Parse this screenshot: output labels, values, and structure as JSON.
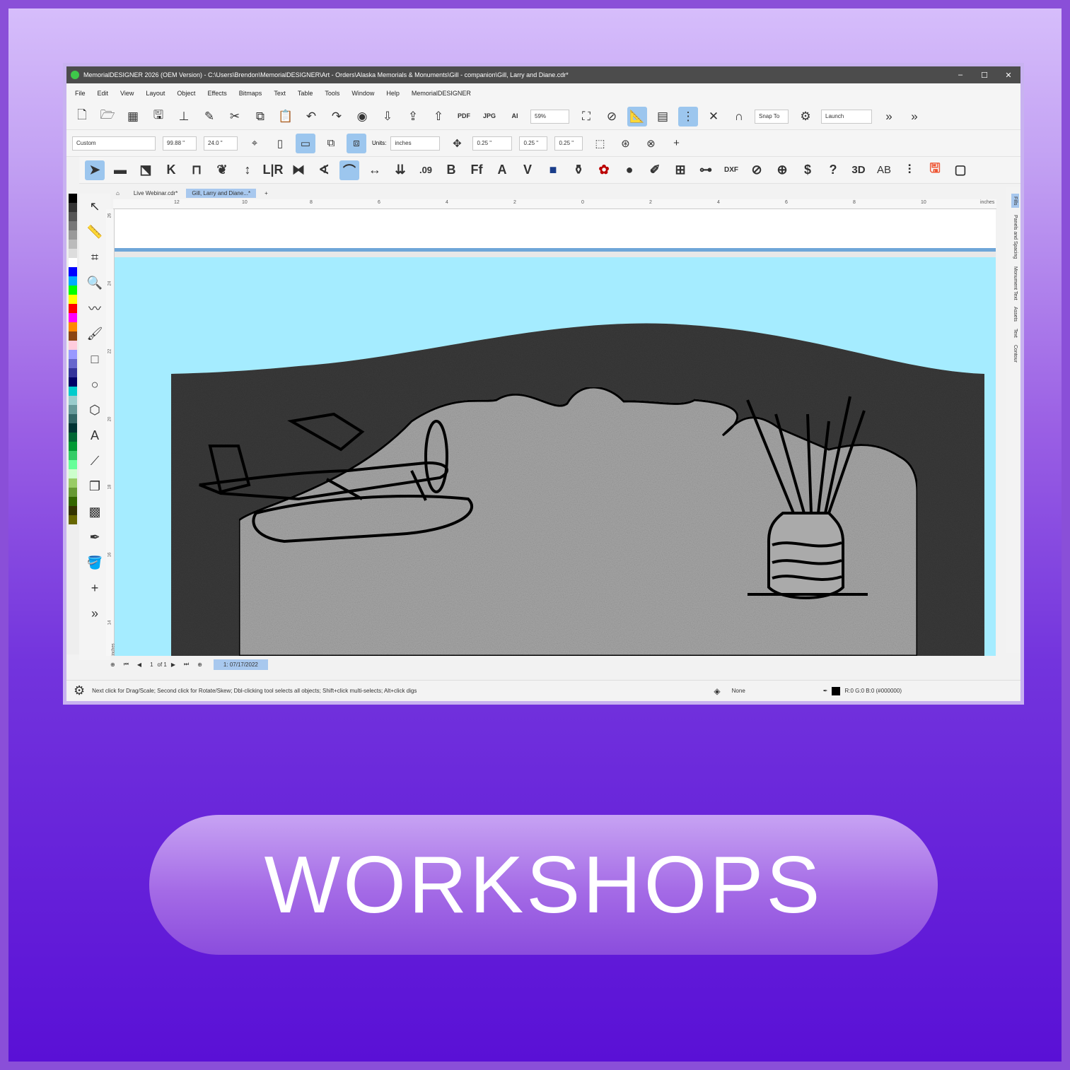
{
  "window": {
    "title": "MemorialDESIGNER 2026 (OEM Version) - C:\\Users\\Brendon\\MemorialDESIGNER\\Art - Orders\\Alaska Memorials & Monuments\\Gill - companion\\Gill, Larry and Diane.cdr*",
    "controls": [
      "–",
      "☐",
      "✕"
    ]
  },
  "menu": [
    "File",
    "Edit",
    "View",
    "Layout",
    "Object",
    "Effects",
    "Bitmaps",
    "Text",
    "Table",
    "Tools",
    "Window",
    "Help",
    "MemorialDESIGNER"
  ],
  "toolbar": {
    "pdf": "PDF",
    "jpg": "JPG",
    "ai": "AI",
    "zoom": "59%",
    "snap": "Snap To",
    "launch": "Launch"
  },
  "propbar": {
    "preset": "Custom",
    "width": "99.88 \"",
    "height": "24.0 \"",
    "units_label": "Units:",
    "units": "inches",
    "nudge": "0.25 \"",
    "dup_x": "0.25 \"",
    "dup_y": "0.25 \""
  },
  "tools3": {
    "b": "B",
    "a": "A",
    "v": "V",
    "dollar": "$",
    "q": "?",
    "three_d": "3D",
    "ab": "AB",
    "num": ".09",
    "lr": "L|R"
  },
  "tabs": [
    "Live Webinar.cdr*",
    "Gill, Larry and Diane...*"
  ],
  "ruler_h": [
    "12",
    "10",
    "8",
    "6",
    "4",
    "2",
    "0",
    "2",
    "4",
    "6",
    "8",
    "10",
    "inches"
  ],
  "ruler_v": [
    "26",
    "24",
    "22",
    "20",
    "18",
    "16",
    "14",
    "inches"
  ],
  "dock": [
    "Fills",
    "Panels and Spacing",
    "Monument Text",
    "Assets",
    "Text",
    "Contour"
  ],
  "pager": {
    "page": "1",
    "of": "of 1",
    "page_tab": "1: 07/17/2022"
  },
  "status": {
    "hint": "Next click for Drag/Scale; Second click for Rotate/Skew; Dbl-clicking tool selects all objects; Shift+click multi-selects; Alt+click digs",
    "fill": "None",
    "outline": "R:0 G:0 B:0 (#000000)"
  },
  "banner": {
    "label": "WORKSHOPS"
  },
  "palette": [
    "#000000",
    "#333333",
    "#555555",
    "#777777",
    "#999999",
    "#bbbbbb",
    "#dddddd",
    "#ffffff",
    "#0000ff",
    "#00aaff",
    "#00ff00",
    "#ffff00",
    "#ff0000",
    "#ff00ff",
    "#ff8800",
    "#8b4513",
    "#ffccdd",
    "#9999ff",
    "#6666cc",
    "#333399",
    "#000066",
    "#00cccc",
    "#99cccc",
    "#669999",
    "#336666",
    "#003333",
    "#006633",
    "#009933",
    "#33cc66",
    "#66ff99",
    "#ccffcc",
    "#99cc66",
    "#669933",
    "#336600",
    "#333300",
    "#666600"
  ]
}
